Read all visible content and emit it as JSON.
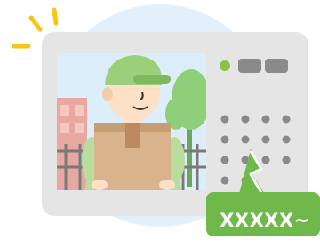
{
  "speech_bubble": {
    "text": "XXXXX~"
  },
  "colors": {
    "backdrop_circle": "#e2f0fb",
    "device_body": "#e5e5e5",
    "screen_sky": "#dbeef9",
    "led_green": "#8bc34a",
    "button_gray": "#8a8a8a",
    "speaker_dot": "#8a8a8a",
    "speech_bubble": "#6fb84a",
    "alert_lines": "#f5c518",
    "cap_green": "#9ccf7a",
    "skin": "#fde0c5",
    "parcel": "#d9b38c",
    "tree": "#8fcf7a",
    "building": "#e8a8a0",
    "fence": "#7a7a7a"
  },
  "icons": [
    "alert-lines-icon",
    "led-indicator",
    "speaker-grille",
    "delivery-person",
    "parcel-box",
    "speech-bubble"
  ]
}
